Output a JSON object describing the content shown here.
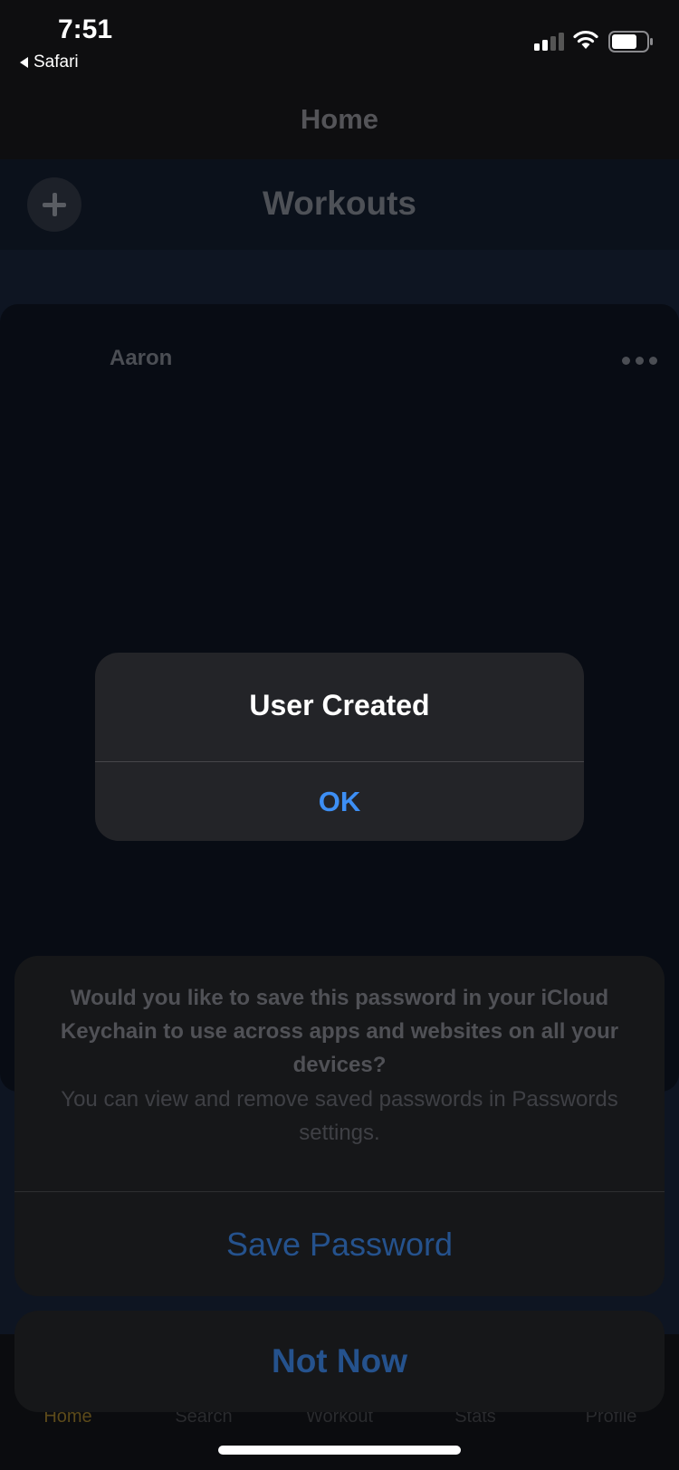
{
  "status_bar": {
    "time": "7:51",
    "back_app": "Safari"
  },
  "nav": {
    "title": "Home"
  },
  "workouts_bar": {
    "title": "Workouts"
  },
  "card": {
    "user": "Aaron"
  },
  "alert": {
    "title": "User Created",
    "ok_label": "OK"
  },
  "keychain_sheet": {
    "message": "Would you like to save this password in your iCloud Keychain to use across apps and websites on all your devices?",
    "detail": "You can view and remove saved passwords in Passwords settings.",
    "save_label": "Save Password",
    "cancel_label": "Not Now"
  },
  "tab_bar": {
    "items": [
      {
        "label": "Home"
      },
      {
        "label": "Search"
      },
      {
        "label": "Workout"
      },
      {
        "label": "Stats"
      },
      {
        "label": "Profile"
      }
    ]
  },
  "colors": {
    "accent_blue": "#3d8ff5",
    "sheet_action_blue": "#25528d",
    "active_tab": "#5c4a1a"
  }
}
